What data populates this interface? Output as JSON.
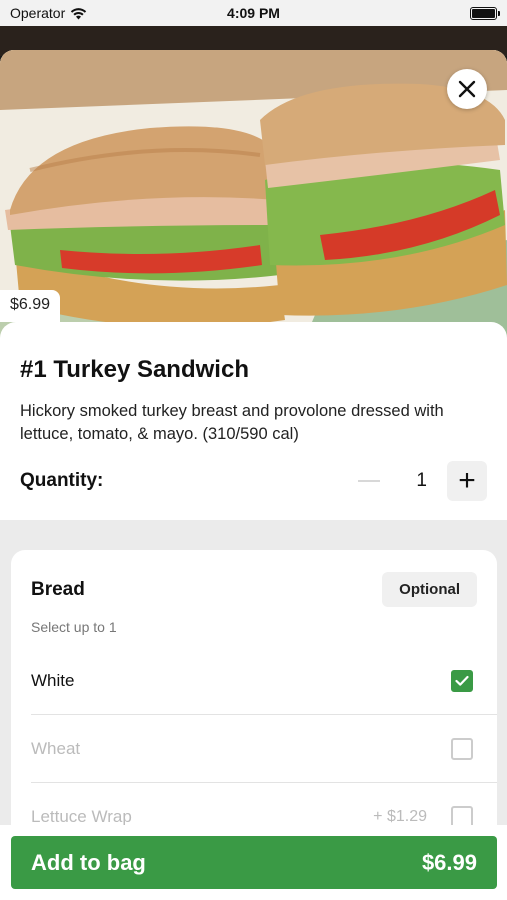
{
  "status_bar": {
    "carrier": "Operator",
    "time": "4:09 PM"
  },
  "product": {
    "price_tag": "$6.99",
    "title": "#1 Turkey Sandwich",
    "description": "Hickory smoked turkey breast and provolone dressed with lettuce, tomato, & mayo. (310/590 cal)",
    "quantity_label": "Quantity:",
    "quantity": "1",
    "plus": "+"
  },
  "bread_section": {
    "heading": "Bread",
    "badge": "Optional",
    "subtext": "Select up to 1",
    "options": [
      {
        "label": "White",
        "price": "",
        "checked": true,
        "disabled": false
      },
      {
        "label": "Wheat",
        "price": "",
        "checked": false,
        "disabled": true
      },
      {
        "label": "Lettuce Wrap",
        "price": "+ $1.29",
        "checked": false,
        "disabled": true
      }
    ]
  },
  "cta": {
    "label": "Add to bag",
    "price": "$6.99"
  },
  "colors": {
    "accent": "#3a9a45"
  },
  "icons": [
    "wifi-icon",
    "battery-icon",
    "close-icon",
    "check-icon"
  ]
}
